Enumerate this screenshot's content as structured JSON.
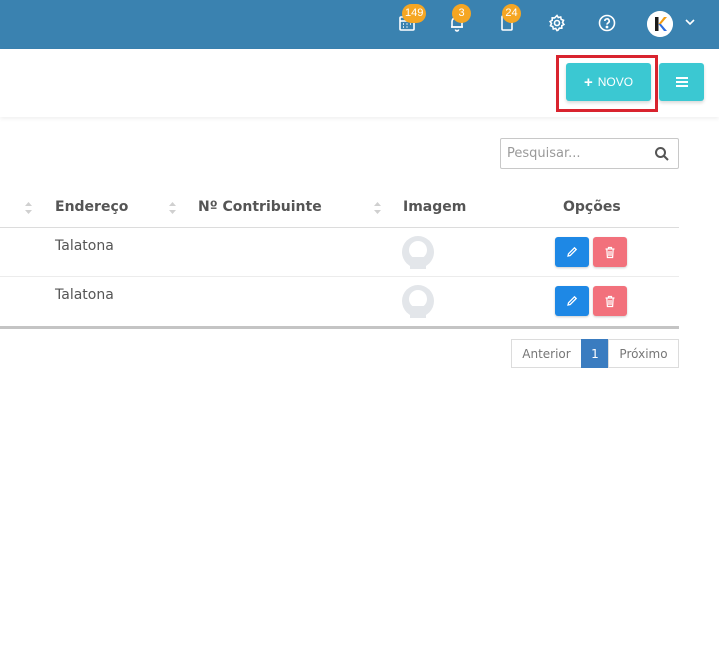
{
  "topbar": {
    "calendar_badge": "149",
    "notifications_badge": "3",
    "tasks_badge": "24",
    "color": "#3a82b0",
    "badge_color": "#f5a623"
  },
  "toolbar": {
    "new_button_label": "NOVO",
    "accent_color": "#3bc8d2",
    "highlight_color": "#d9232e"
  },
  "search": {
    "placeholder": "Pesquisar...",
    "value": ""
  },
  "table": {
    "columns": [
      "Endereço",
      "Nº Contribuinte",
      "Imagem",
      "Opções"
    ],
    "rows": [
      {
        "endereco": "Talatona",
        "contribuinte": ""
      },
      {
        "endereco": "Talatona",
        "contribuinte": ""
      }
    ]
  },
  "pagination": {
    "previous_label": "Anterior",
    "current_page": "1",
    "next_label": "Próximo"
  }
}
